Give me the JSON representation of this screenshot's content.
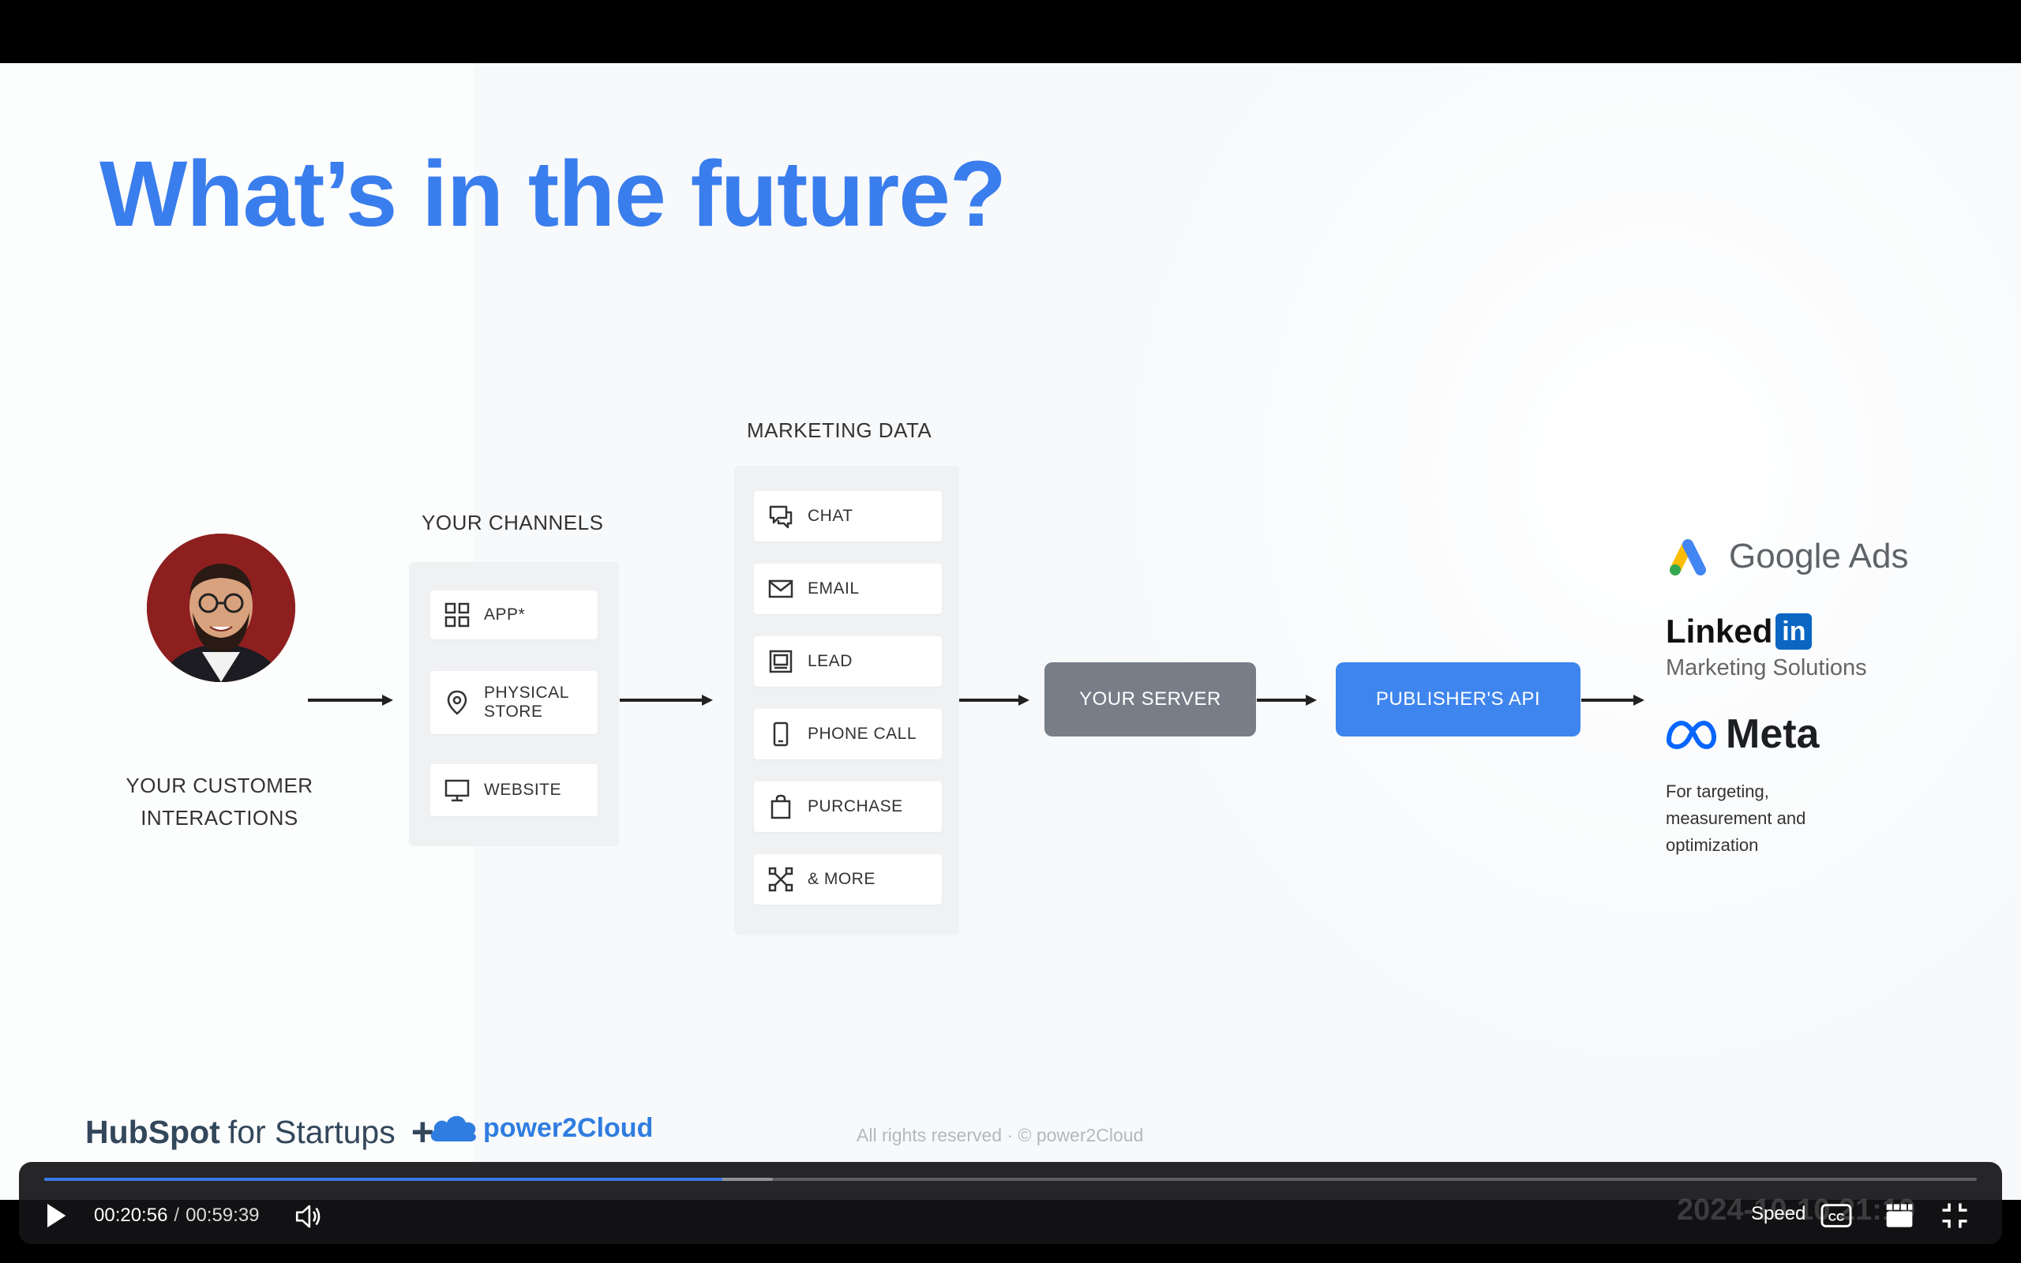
{
  "slide": {
    "title": "What’s in the future?",
    "customer_label": "YOUR CUSTOMER\nINTERACTIONS",
    "channels_heading": "YOUR CHANNELS",
    "channels": [
      {
        "icon": "grid-icon",
        "label": "APP*"
      },
      {
        "icon": "location-pin-icon",
        "label": "PHYSICAL\nSTORE"
      },
      {
        "icon": "monitor-icon",
        "label": "WEBSITE"
      }
    ],
    "marketing_heading": "MARKETING DATA",
    "marketing_items": [
      {
        "icon": "chat-icon",
        "label": "CHAT"
      },
      {
        "icon": "envelope-icon",
        "label": "EMAIL"
      },
      {
        "icon": "lead-form-icon",
        "label": "LEAD"
      },
      {
        "icon": "phone-icon",
        "label": "PHONE CALL"
      },
      {
        "icon": "shopping-bag-icon",
        "label": "PURCHASE"
      },
      {
        "icon": "network-icon",
        "label": "& MORE"
      }
    ],
    "server_label": "YOUR SERVER",
    "api_label": "PUBLISHER'S API",
    "destinations": {
      "google": "Google Ads",
      "linkedin_text": "Linked",
      "linkedin_badge": "in",
      "linkedin_sub": "Marketing Solutions",
      "meta": "Meta",
      "note": "For targeting, measurement and optimization"
    },
    "footer": {
      "hubspot_brand": "HubSpot",
      "hubspot_sub": "for Startups",
      "plus": "+",
      "partner": "power2Cloud",
      "copyright": "All rights reserved · © power2Cloud"
    }
  },
  "player": {
    "current_time": "00:20:56",
    "separator": "/",
    "duration": "00:59:39",
    "progress_fraction": 0.351,
    "buffered_fraction": 0.377,
    "speed_label": "Speed",
    "cc_label": "CC",
    "watermark": "2024-10-10 21:19",
    "colors": {
      "progress": "#3d78e6",
      "title": "#3a7ded",
      "api": "#3e85ee",
      "server": "#777e88"
    }
  }
}
